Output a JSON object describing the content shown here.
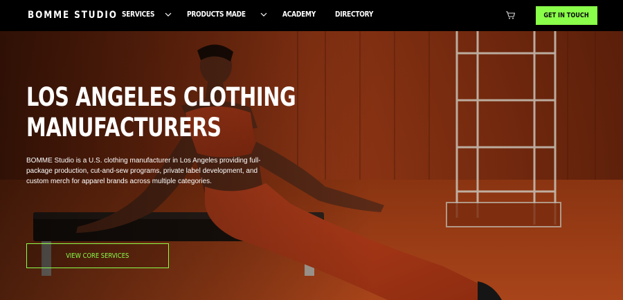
{
  "header": {
    "logo": "BOMME STUDIO",
    "nav": [
      {
        "label": "SERVICES",
        "has_dropdown": true
      },
      {
        "label": "PRODUCTS MADE",
        "has_dropdown": true
      },
      {
        "label": "ACADEMY",
        "has_dropdown": false
      },
      {
        "label": "DIRECTORY",
        "has_dropdown": false
      }
    ],
    "cart_icon": "cart-icon",
    "cta_label": "GET IN TOUCH"
  },
  "hero": {
    "headline_line1": "LOS ANGELES CLOTHING",
    "headline_line2": "MANUFACTURERS",
    "description": "BOMME Studio is a U.S. clothing manufacturer in Los Angeles providing full-package production, cut-and-sew programs, private label development, and custom merch for apparel brands across multiple categories.",
    "button_label": "VIEW CORE SERVICES",
    "image": "woman in rust-red activewear seated on a bench in an orange studio with a metal shelving unit"
  },
  "colors": {
    "accent": "#8aff4a",
    "nav_bg": "#000000",
    "hero_tone": "#7a2d10"
  }
}
